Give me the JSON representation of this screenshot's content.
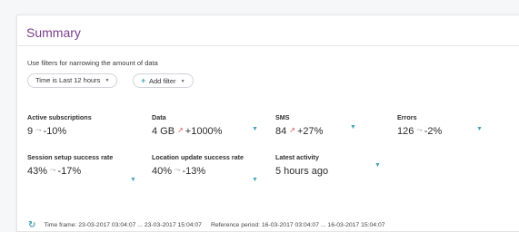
{
  "summary": {
    "title": "Summary",
    "filter_hint": "Use filters for narrowing the amount of data",
    "time_filter": {
      "prefix": "Time is",
      "value": "Last 12 hours"
    },
    "add_filter_label": "Add filter"
  },
  "metrics": [
    {
      "label": "Active subscriptions",
      "value": "9",
      "trend": "down",
      "change": "-10%"
    },
    {
      "label": "Data",
      "value": "4 GB",
      "trend": "up",
      "change": "+1000%"
    },
    {
      "label": "SMS",
      "value": "84",
      "trend": "up",
      "change": "+27%"
    },
    {
      "label": "Errors",
      "value": "126",
      "trend": "down",
      "change": "-2%"
    },
    {
      "label": "Session setup success rate",
      "value": "43%",
      "trend": "down",
      "change": "-17%"
    },
    {
      "label": "Location update success rate",
      "value": "40%",
      "trend": "down",
      "change": "-13%"
    },
    {
      "label": "Latest activity",
      "value": "5 hours ago"
    }
  ],
  "footer": {
    "time_frame": "Time frame: 23-03-2017 03:04:07 ... 23-03-2017 15:04:07",
    "reference_period": "Reference period: 16-03-2017 03:04:07 ... 16-03-2017 15:04:07"
  },
  "colors": {
    "title": "#7b3e8c",
    "accent": "#4aa3b8",
    "trend_up": "#d9534f",
    "trend_down": "#9aa1a8"
  },
  "icons": {
    "filter": "funnel-icon",
    "trend_up": "trend-up-icon",
    "trend_down": "trend-down-icon",
    "refresh": "refresh-icon"
  }
}
